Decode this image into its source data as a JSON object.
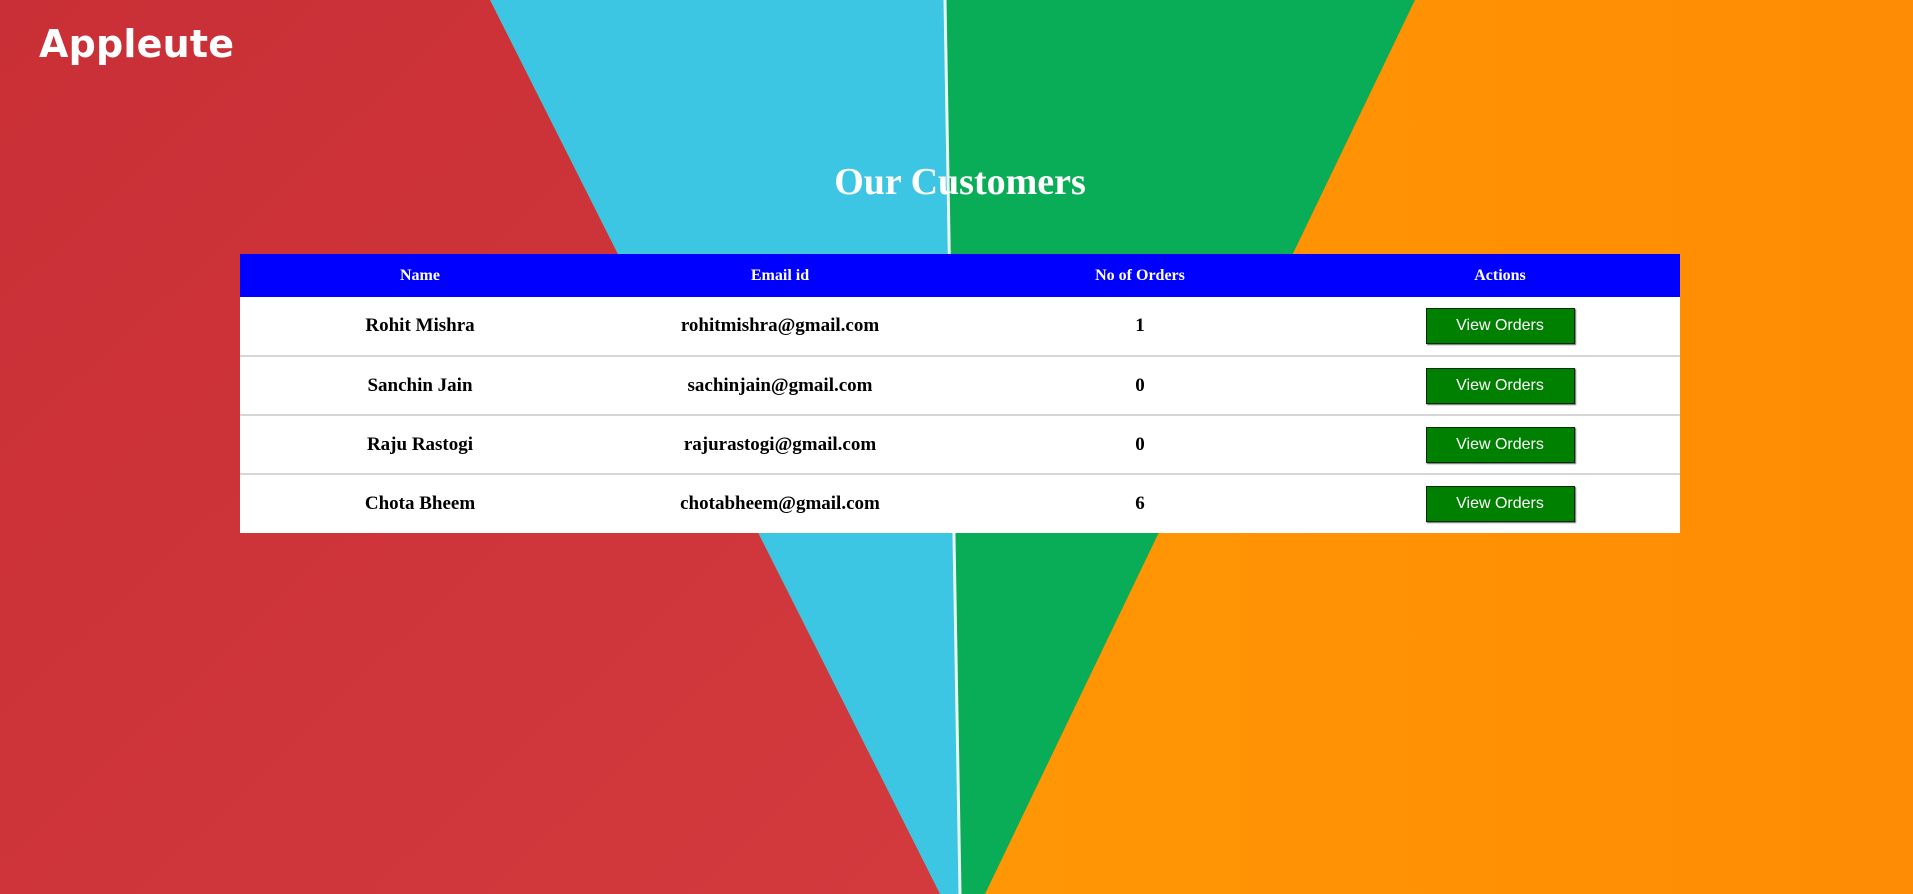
{
  "brand": {
    "name": "Appleute"
  },
  "page": {
    "title": "Our Customers"
  },
  "table": {
    "headers": [
      "Name",
      "Email id",
      "No of Orders",
      "Actions"
    ],
    "rows": [
      {
        "name": "Rohit Mishra",
        "email": "rohitmishra@gmail.com",
        "orders": "1",
        "action_label": "View Orders"
      },
      {
        "name": "Sanchin Jain",
        "email": "sachinjain@gmail.com",
        "orders": "0",
        "action_label": "View Orders"
      },
      {
        "name": "Raju Rastogi",
        "email": "rajurastogi@gmail.com",
        "orders": "0",
        "action_label": "View Orders"
      },
      {
        "name": "Chota Bheem",
        "email": "chotabheem@gmail.com",
        "orders": "6",
        "action_label": "View Orders"
      }
    ]
  },
  "colors": {
    "header_bg": "#0000ff",
    "button_bg": "#008000",
    "bg_red": "#cf343a",
    "bg_blue": "#3cc6e4",
    "bg_green": "#09ad58",
    "bg_orange": "#ff9a02"
  }
}
